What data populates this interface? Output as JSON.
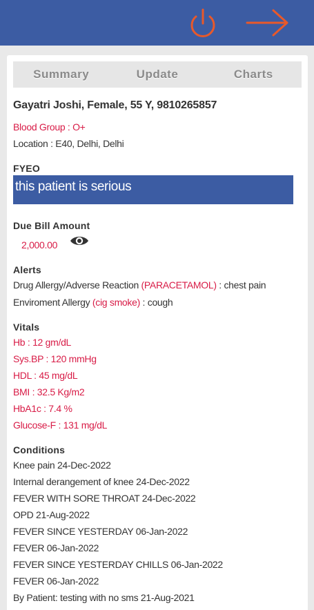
{
  "header": {
    "power_icon": "power-icon",
    "forward_icon": "arrow-right-icon",
    "accent": "#e8592a",
    "bg": "#3c5ca3"
  },
  "tabs": [
    {
      "label": "Summary"
    },
    {
      "label": "Update"
    },
    {
      "label": "Charts"
    }
  ],
  "patient": {
    "name_line": "Gayatri Joshi, Female, 55 Y, 9810265857",
    "blood_group": "Blood Group : O+",
    "location": "Location : E40, Delhi, Delhi"
  },
  "fyeo": {
    "heading": "FYEO",
    "note": "this patient is serious"
  },
  "bill": {
    "heading": "Due Bill Amount",
    "amount": "2,000.00",
    "eye_icon": "eye-icon"
  },
  "alerts": {
    "heading": "Alerts",
    "items": [
      {
        "label": "Drug Allergy/Adverse Reaction",
        "agent": "(PARACETAMOL)",
        "reaction": " : chest pain"
      },
      {
        "label": "Enviroment Allergy",
        "agent": "(cig smoke)",
        "reaction": " : cough"
      }
    ]
  },
  "vitals": {
    "heading": "Vitals",
    "items": [
      "Hb : 12 gm/dL",
      "Sys.BP : 120 mmHg",
      "HDL : 45 mg/dL",
      "BMI : 32.5 Kg/m2",
      "HbA1c : 7.4 %",
      "Glucose-F : 131 mg/dL"
    ]
  },
  "conditions": {
    "heading": "Conditions",
    "items": [
      "Knee pain 24-Dec-2022",
      "Internal derangement of knee 24-Dec-2022",
      "FEVER WITH SORE THROAT 24-Dec-2022",
      "OPD 21-Aug-2022",
      "FEVER SINCE YESTERDAY 06-Jan-2022",
      "FEVER 06-Jan-2022",
      "FEVER SINCE YESTERDAY CHILLS 06-Jan-2022",
      "FEVER 06-Jan-2022",
      "By Patient: testing with no sms 21-Aug-2021"
    ]
  }
}
